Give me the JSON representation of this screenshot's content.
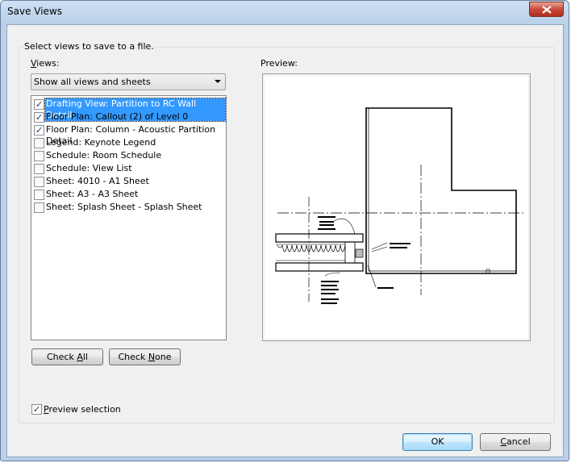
{
  "window": {
    "title": "Save Views"
  },
  "instruction": "Select views to save to a file.",
  "views_label": "Views:",
  "views_label_mnemonic": "V",
  "views_label_rest": "iews:",
  "views_filter": {
    "selected": "Show all views and sheets"
  },
  "views_list": [
    {
      "label": "Drafting View: Partition to RC Wall Detail",
      "checked": true,
      "selected": true
    },
    {
      "label": "Floor Plan: Callout (2) of Level 0",
      "checked": true,
      "selected": false
    },
    {
      "label": "Floor Plan: Column - Acoustic Partition Detail",
      "checked": true,
      "selected": false
    },
    {
      "label": "Legend: Keynote Legend",
      "checked": false,
      "selected": false
    },
    {
      "label": "Schedule: Room Schedule",
      "checked": false,
      "selected": false
    },
    {
      "label": "Schedule: View List",
      "checked": false,
      "selected": false
    },
    {
      "label": "Sheet: 4010 - A1 Sheet",
      "checked": false,
      "selected": false
    },
    {
      "label": "Sheet: A3 - A3 Sheet",
      "checked": false,
      "selected": false
    },
    {
      "label": "Sheet: Splash Sheet - Splash Sheet",
      "checked": false,
      "selected": false
    }
  ],
  "preview_label": "Preview:",
  "buttons": {
    "check_all_pre": "Check ",
    "check_all_mn": "A",
    "check_all_post": "ll",
    "check_none_pre": "Check ",
    "check_none_mn": "N",
    "check_none_post": "one",
    "ok": "OK",
    "cancel_mn": "C",
    "cancel_post": "ancel"
  },
  "preview_selection": {
    "mn": "P",
    "rest": "review selection",
    "checked": true
  },
  "colors": {
    "selection": "#3399ff",
    "close": "#c9493a",
    "client_bg": "#f0f0f0"
  }
}
